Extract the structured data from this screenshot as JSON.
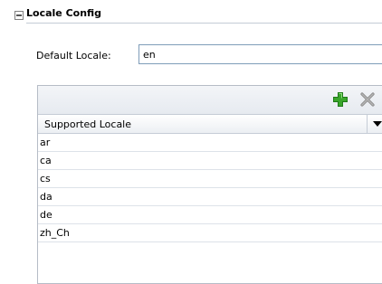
{
  "section": {
    "title": "Locale Config"
  },
  "default_locale": {
    "label": "Default Locale:",
    "value": "en"
  },
  "table": {
    "column_header": "Supported Locale",
    "rows": [
      "ar",
      "ca",
      "cs",
      "da",
      "de",
      "zh_Ch"
    ]
  },
  "icons": {
    "collapse": "minus-box-icon",
    "add": "plus-icon",
    "delete": "x-icon",
    "sort": "triangle-down-icon"
  },
  "colors": {
    "add_icon": "#3aa52b",
    "delete_icon": "#8c8c8c",
    "input_border": "#7f9db9"
  }
}
